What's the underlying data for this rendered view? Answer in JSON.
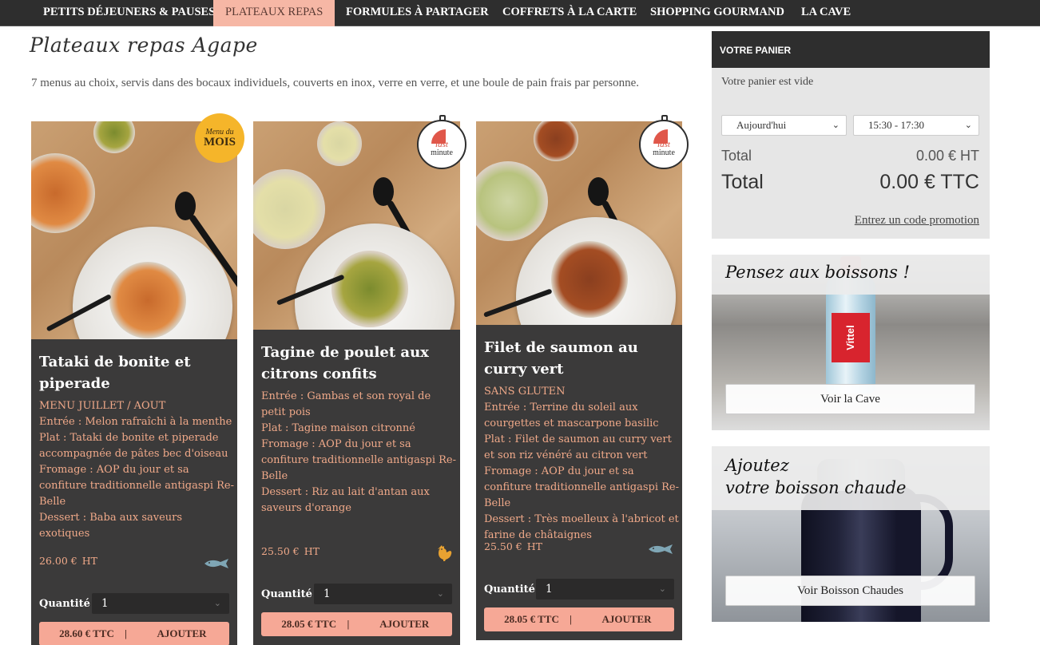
{
  "nav": {
    "items": [
      {
        "label": "PETITS DÉJEUNERS & PAUSES",
        "active": false
      },
      {
        "label": "PLATEAUX REPAS",
        "active": true
      },
      {
        "label": "FORMULES À PARTAGER",
        "active": false
      },
      {
        "label": "COFFRETS À LA CARTE",
        "active": false
      },
      {
        "label": "SHOPPING GOURMAND",
        "active": false
      },
      {
        "label": "LA CAVE",
        "active": false
      }
    ]
  },
  "page": {
    "title": "Plateaux repas Agape",
    "intro": "7 menus au choix, servis dans des bocaux individuels, couverts en inox, verre en verre, et une boule de pain frais par personne."
  },
  "products": [
    {
      "name": "Tataki de bonite et piperade",
      "badge": {
        "type": "menu-du-mois",
        "line1": "Menu du",
        "line2": "MOIS"
      },
      "description": [
        "MENU JUILLET / AOUT",
        "Entrée : Melon rafraîchi à la menthe",
        "Plat : Tataki de bonite et piperade accompagnée de pâtes bec d'oiseau",
        "Fromage : AOP du jour et sa confiture traditionnelle antigaspi Re-Belle",
        "Dessert : Baba aux saveurs exotiques"
      ],
      "price": "26.00 €",
      "price_unit": "HT",
      "icon": "fish-icon",
      "quantity_label": "Quantité",
      "quantity": "1",
      "price_ttc": "28.60 € TTC",
      "separator": "|",
      "add_label": "AJOUTER"
    },
    {
      "name": "Tagine de poulet aux citrons confits",
      "badge": {
        "type": "last-minute",
        "line1": "last",
        "line2": "minute"
      },
      "description": [
        "Entrée : Gambas et son royal de petit pois",
        "Plat : Tagine maison citronné",
        "Fromage : AOP du jour et sa confiture traditionnelle antigaspi Re-Belle",
        "Dessert : Riz au lait d'antan aux saveurs d'orange"
      ],
      "price": "25.50 €",
      "price_unit": "HT",
      "icon": "chicken-icon",
      "quantity_label": "Quantité",
      "quantity": "1",
      "price_ttc": "28.05 € TTC",
      "separator": "|",
      "add_label": "AJOUTER"
    },
    {
      "name": "Filet de saumon au curry vert",
      "badge": {
        "type": "last-minute",
        "line1": "last",
        "line2": "minute"
      },
      "description": [
        "SANS GLUTEN",
        "Entrée : Terrine du soleil aux courgettes et mascarpone basilic",
        "Plat : Filet de saumon au curry vert et son riz vénéré au citron vert",
        "Fromage : AOP du jour et sa confiture traditionnelle antigaspi Re-Belle",
        "Dessert : Très moelleux à l'abricot et farine de châtaignes"
      ],
      "price": "25.50 €",
      "price_unit": "HT",
      "icon": "fish-icon",
      "quantity_label": "Quantité",
      "quantity": "1",
      "price_ttc": "28.05 € TTC",
      "separator": "|",
      "add_label": "AJOUTER"
    }
  ],
  "cart": {
    "title": "VOTRE PANIER",
    "empty_text": "Votre panier est vide",
    "date_value": "Aujourd'hui",
    "time_value": "15:30 - 17:30",
    "total_ht_label": "Total",
    "total_ht_value": "0.00 € HT",
    "total_ttc_label": "Total",
    "total_ttc_value": "0.00 € TTC",
    "promo_link": "Entrez un code promotion"
  },
  "promos": [
    {
      "title": "Pensez aux boissons !",
      "bottle_label": "Vittel",
      "button": "Voir la Cave"
    },
    {
      "title_line1": "Ajoutez",
      "title_line2": "votre boisson chaude",
      "button": "Voir Boisson Chaudes"
    }
  ],
  "colors": {
    "accent": "#f6a896",
    "card_bg": "#3b3a3a",
    "nav_bg": "#2e2e2e",
    "desc_text": "#f0a989"
  }
}
